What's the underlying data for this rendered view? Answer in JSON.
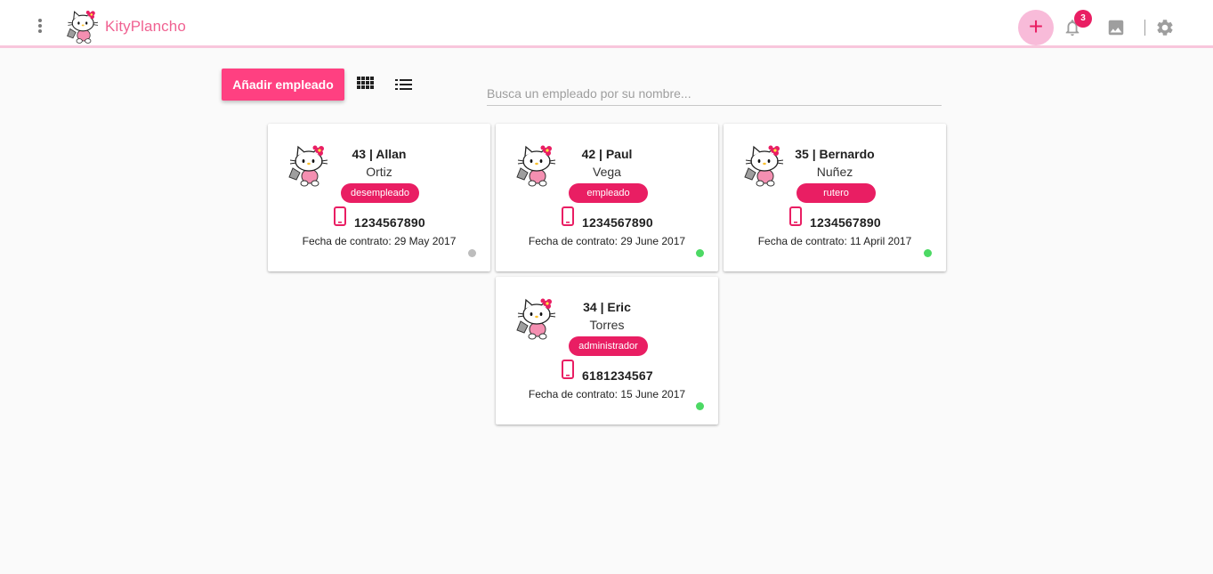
{
  "app": {
    "title": "KityPlancho"
  },
  "topbar": {
    "add_label": "+",
    "notifications_count": "3"
  },
  "toolbar": {
    "add_employee_label": "Añadir empleado",
    "search_placeholder": "Busca un empleado por su nombre..."
  },
  "colors": {
    "accent": "#e91e63",
    "button": "#ff4081",
    "active_status": "#4cd964",
    "inactive_status": "#bdbdbd"
  },
  "employees": [
    {
      "heading": "43 | Allan",
      "last_name": "Ortiz",
      "role": "desempleado",
      "phone": "1234567890",
      "hire_date": "Fecha de contrato: 29 May 2017",
      "status": "inactive"
    },
    {
      "heading": "42 | Paul",
      "last_name": "Vega",
      "role": "empleado",
      "phone": "1234567890",
      "hire_date": "Fecha de contrato: 29 June 2017",
      "status": "active"
    },
    {
      "heading": "35 | Bernardo",
      "last_name": "Nuñez",
      "role": "rutero",
      "phone": "1234567890",
      "hire_date": "Fecha de contrato: 11 April 2017",
      "status": "active"
    },
    {
      "heading": "34 | Eric",
      "last_name": "Torres",
      "role": "administrador",
      "phone": "6181234567",
      "hire_date": "Fecha de contrato: 15 June 2017",
      "status": "active"
    }
  ]
}
